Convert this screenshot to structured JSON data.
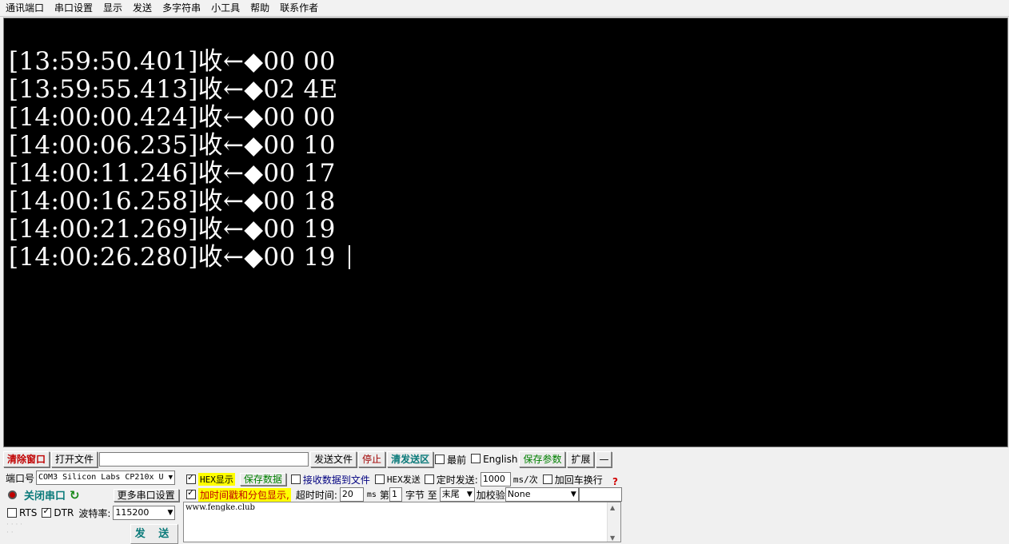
{
  "menu": [
    "通讯端口",
    "串口设置",
    "显示",
    "发送",
    "多字符串",
    "小工具",
    "帮助",
    "联系作者"
  ],
  "receive": {
    "lines": [
      "[13:59:50.401]收←◆00 00",
      "[13:59:55.413]收←◆02 4E",
      "[14:00:00.424]收←◆00 00",
      "[14:00:06.235]收←◆00 10",
      "[14:00:11.246]收←◆00 17",
      "[14:00:16.258]收←◆00 18",
      "[14:00:21.269]收←◆00 19",
      "[14:00:26.280]收←◆00 19 "
    ]
  },
  "toolbar": {
    "clear_window": "清除窗口",
    "open_file": "打开文件",
    "file_path": "",
    "send_file": "发送文件",
    "stop": "停止",
    "clear_send": "清发送区",
    "front_label": "最前",
    "english_label": "English",
    "save_params": "保存参数",
    "expand": "扩展",
    "collapse": "—"
  },
  "port": {
    "port_label": "端口号",
    "port_value": "COM3 Silicon Labs CP210x U",
    "more_settings": "更多串口设置",
    "close_port": "关闭串口",
    "rts_label": "RTS",
    "dtr_label": "DTR",
    "baud_label": "波特率:",
    "baud_value": "115200",
    "send_button": "发 送"
  },
  "options": {
    "hex_display": "HEX显示",
    "save_data": "保存数据",
    "recv_to_file": "接收数据到文件",
    "hex_send": "HEX发送",
    "timed_send": "定时发送:",
    "interval": "1000",
    "interval_unit": "ms/次",
    "append_crlf": "加回车换行",
    "timestamp_label": "加时间戳和分包显示,",
    "timeout_label": "超时时间:",
    "timeout_value": "20",
    "timeout_unit": "ms",
    "byte_prefix": "第",
    "byte_index": "1",
    "byte_suffix": "字节 至",
    "byte_end": "末尾",
    "checksum_label": "加校验",
    "checksum_value": "None",
    "help": "?"
  },
  "send_text": "www.fengke.club",
  "colors": {
    "terminal_bg": "#000000",
    "terminal_fg": "#ffffff",
    "accent_teal": "#0a7a7a",
    "highlight": "#ffff00"
  }
}
